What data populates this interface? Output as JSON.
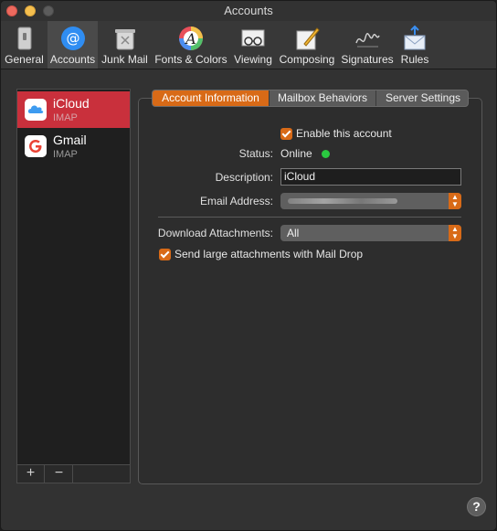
{
  "window": {
    "title": "Accounts"
  },
  "toolbar": {
    "items": [
      {
        "label": "General",
        "icon": "general-switch-icon"
      },
      {
        "label": "Accounts",
        "icon": "at-sign-icon",
        "active": true
      },
      {
        "label": "Junk Mail",
        "icon": "trash-can-icon"
      },
      {
        "label": "Fonts & Colors",
        "icon": "color-wheel-font-icon"
      },
      {
        "label": "Viewing",
        "icon": "glasses-icon"
      },
      {
        "label": "Composing",
        "icon": "pencil-paper-icon"
      },
      {
        "label": "Signatures",
        "icon": "signature-icon"
      },
      {
        "label": "Rules",
        "icon": "envelope-arrows-icon"
      }
    ]
  },
  "sidebar": {
    "accounts": [
      {
        "name": "iCloud",
        "type": "IMAP",
        "icon": "icloud-icon",
        "selected": true
      },
      {
        "name": "Gmail",
        "type": "IMAP",
        "icon": "google-icon"
      }
    ],
    "add_label": "+",
    "remove_label": "−"
  },
  "tabs": {
    "account_information": "Account Information",
    "mailbox_behaviors": "Mailbox Behaviors",
    "server_settings": "Server Settings"
  },
  "form": {
    "enable_label": "Enable this account",
    "enable_checked": true,
    "status_label": "Status:",
    "status_value": "Online",
    "description_label": "Description:",
    "description_value": "iCloud",
    "email_label": "Email Address:",
    "download_label": "Download Attachments:",
    "download_value": "All",
    "maildrop_label": "Send large attachments with Mail Drop",
    "maildrop_checked": true
  },
  "help_label": "?",
  "colors": {
    "accent": "#d86a17",
    "selection": "#c9303c",
    "online": "#2ac840"
  }
}
